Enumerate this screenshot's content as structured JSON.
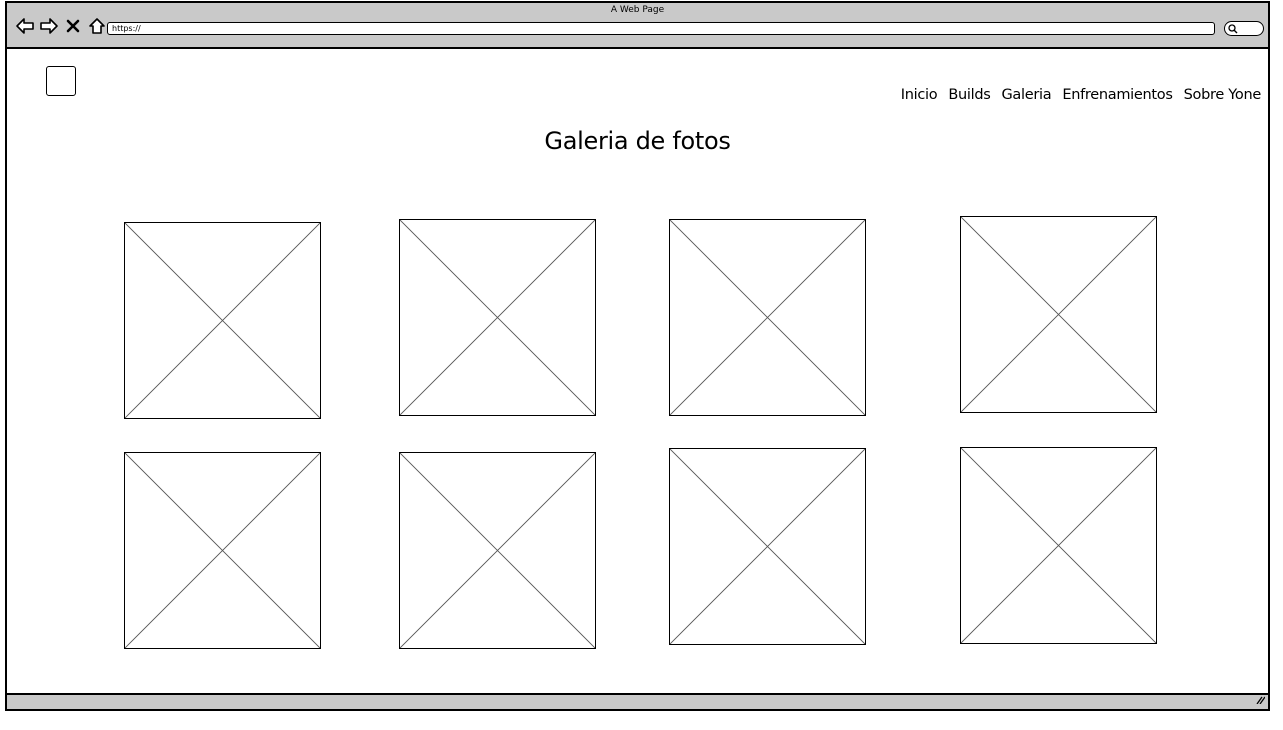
{
  "window": {
    "title": "A Web Page",
    "url": "https://",
    "icons": [
      "back-icon",
      "forward-icon",
      "close-icon",
      "home-icon",
      "search-icon",
      "resize-grip-icon"
    ]
  },
  "header": {
    "logo": "logo-placeholder",
    "nav": [
      {
        "label": "Inicio"
      },
      {
        "label": "Builds"
      },
      {
        "label": "Galeria"
      },
      {
        "label": "Enfrenamientos"
      },
      {
        "label": "Sobre Yone"
      }
    ]
  },
  "main": {
    "title": "Galeria de fotos",
    "gallery_count": 8
  },
  "colors": {
    "chrome": "#c9c9c9",
    "border": "#000000",
    "placeholder_cross": "#555555"
  }
}
